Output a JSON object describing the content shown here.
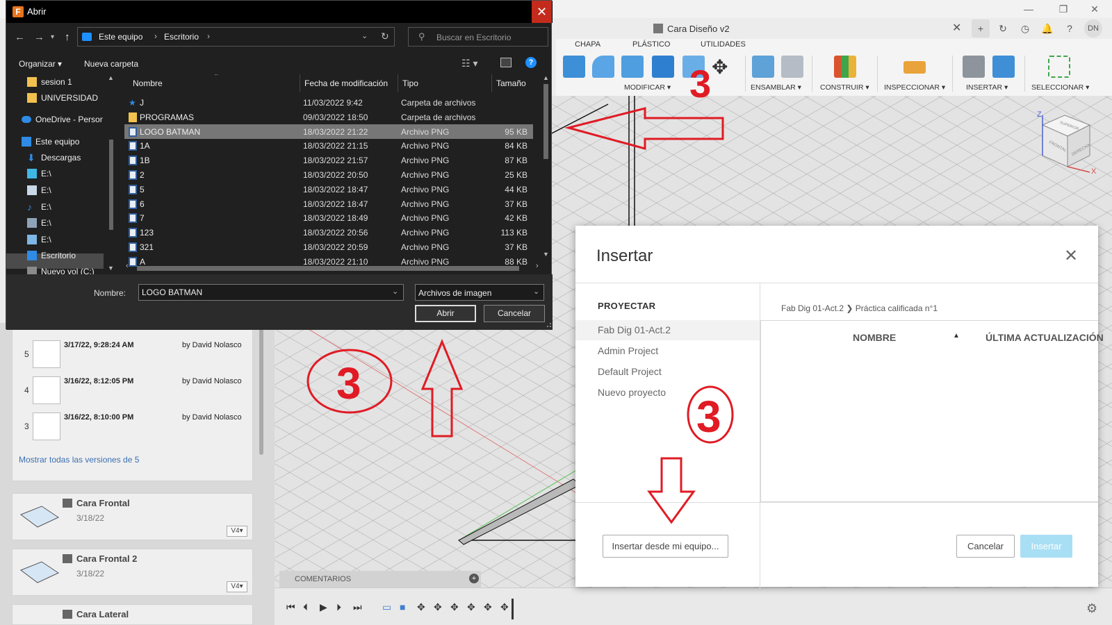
{
  "app": {
    "tab_title": "Cara Diseño v2",
    "user_initials": "DN",
    "ribbon_tabs": [
      "CHAPA",
      "PLÁSTICO",
      "UTILIDADES"
    ],
    "ribbon_groups": [
      "MODIFICAR ▾",
      "ENSAMBLAR ▾",
      "CONSTRUIR ▾",
      "INSPECCIONAR ▾",
      "INSERTAR ▾",
      "SELECCIONAR ▾"
    ],
    "viewcube": {
      "axis_z": "Z",
      "axis_x": "X",
      "faces": [
        "SUPERIOR",
        "FRONTAL",
        "DERECHA"
      ]
    },
    "comments_label": "COMENTARIOS"
  },
  "versions": [
    {
      "num": "5",
      "date": "3/17/22, 9:28:24 AM",
      "by": "by David Nolasco"
    },
    {
      "num": "4",
      "date": "3/16/22, 8:12:05 PM",
      "by": "by David Nolasco"
    },
    {
      "num": "3",
      "date": "3/16/22, 8:10:00 PM",
      "by": "by David Nolasco"
    }
  ],
  "show_all_versions": "Mostrar todas las versiones de 5",
  "files": [
    {
      "title": "Cara Frontal",
      "date": "3/18/22",
      "version": "V4▾"
    },
    {
      "title": "Cara Frontal 2",
      "date": "3/18/22",
      "version": "V4▾"
    },
    {
      "title": "Cara Lateral"
    }
  ],
  "insert_dialog": {
    "title": "Insertar",
    "projects_header": "PROYECTAR",
    "projects": [
      "Fab Dig 01-Act.2",
      "Admin Project",
      "Default Project",
      "Nuevo proyecto"
    ],
    "breadcrumb_1": "Fab Dig 01-Act.2",
    "breadcrumb_sep": "❯",
    "breadcrumb_2": "Práctica calificada n°1",
    "col_name": "NOMBRE",
    "col_updated": "ÚLTIMA ACTUALIZACIÓN",
    "btn_local": "Insertar desde mi equipo...",
    "btn_cancel": "Cancelar",
    "btn_insert": "Insertar",
    "colors": {
      "insert_disabled": "#a9dff4"
    }
  },
  "open_dialog": {
    "title": "Abrir",
    "address": [
      "Este equipo",
      "Escritorio"
    ],
    "search_placeholder": "Buscar en Escritorio",
    "organize": "Organizar ▾",
    "new_folder": "Nueva carpeta",
    "nav": [
      {
        "label": "sesion 1",
        "icon": "folder"
      },
      {
        "label": "UNIVERSIDAD",
        "icon": "folder"
      },
      {
        "label": "OneDrive - Persor",
        "icon": "cloud"
      },
      {
        "label": "Este equipo",
        "icon": "pc"
      },
      {
        "label": "Descargas",
        "icon": "download"
      },
      {
        "label": "E:\\",
        "icon": "cube"
      },
      {
        "label": "E:\\",
        "icon": "doc"
      },
      {
        "label": "E:\\",
        "icon": "music"
      },
      {
        "label": "E:\\",
        "icon": "film"
      },
      {
        "label": "E:\\",
        "icon": "image"
      },
      {
        "label": "Escritorio",
        "icon": "desktop"
      },
      {
        "label": "Nuevo vol (C:)",
        "icon": "drive"
      }
    ],
    "columns": {
      "name": "Nombre",
      "date": "Fecha de modificación",
      "type": "Tipo",
      "size": "Tamaño"
    },
    "rows": [
      {
        "name": "J",
        "date": "11/03/2022 9:42",
        "type": "Carpeta de archivos",
        "size": "",
        "icon": "pin"
      },
      {
        "name": "PROGRAMAS",
        "date": "09/03/2022 18:50",
        "type": "Carpeta de archivos",
        "size": "",
        "icon": "folder"
      },
      {
        "name": "LOGO BATMAN",
        "date": "18/03/2022 21:22",
        "type": "Archivo PNG",
        "size": "95 KB",
        "icon": "file",
        "selected": true
      },
      {
        "name": "1A",
        "date": "18/03/2022 21:15",
        "type": "Archivo PNG",
        "size": "84 KB",
        "icon": "file"
      },
      {
        "name": "1B",
        "date": "18/03/2022 21:57",
        "type": "Archivo PNG",
        "size": "87 KB",
        "icon": "file"
      },
      {
        "name": "2",
        "date": "18/03/2022 20:50",
        "type": "Archivo PNG",
        "size": "25 KB",
        "icon": "file"
      },
      {
        "name": "5",
        "date": "18/03/2022 18:47",
        "type": "Archivo PNG",
        "size": "44 KB",
        "icon": "file"
      },
      {
        "name": "6",
        "date": "18/03/2022 18:47",
        "type": "Archivo PNG",
        "size": "37 KB",
        "icon": "file"
      },
      {
        "name": "7",
        "date": "18/03/2022 18:49",
        "type": "Archivo PNG",
        "size": "42 KB",
        "icon": "file"
      },
      {
        "name": "123",
        "date": "18/03/2022 20:56",
        "type": "Archivo PNG",
        "size": "113 KB",
        "icon": "file"
      },
      {
        "name": "321",
        "date": "18/03/2022 20:59",
        "type": "Archivo PNG",
        "size": "37 KB",
        "icon": "file"
      },
      {
        "name": "A",
        "date": "18/03/2022 21:10",
        "type": "Archivo PNG",
        "size": "88 KB",
        "icon": "file"
      }
    ],
    "filename_label": "Nombre:",
    "filename_value": "LOGO BATMAN",
    "filetype": "Archivos de imagen",
    "btn_open": "Abrir",
    "btn_cancel": "Cancelar"
  },
  "annotations": {
    "step_number": "3",
    "color": "#e01b24"
  }
}
